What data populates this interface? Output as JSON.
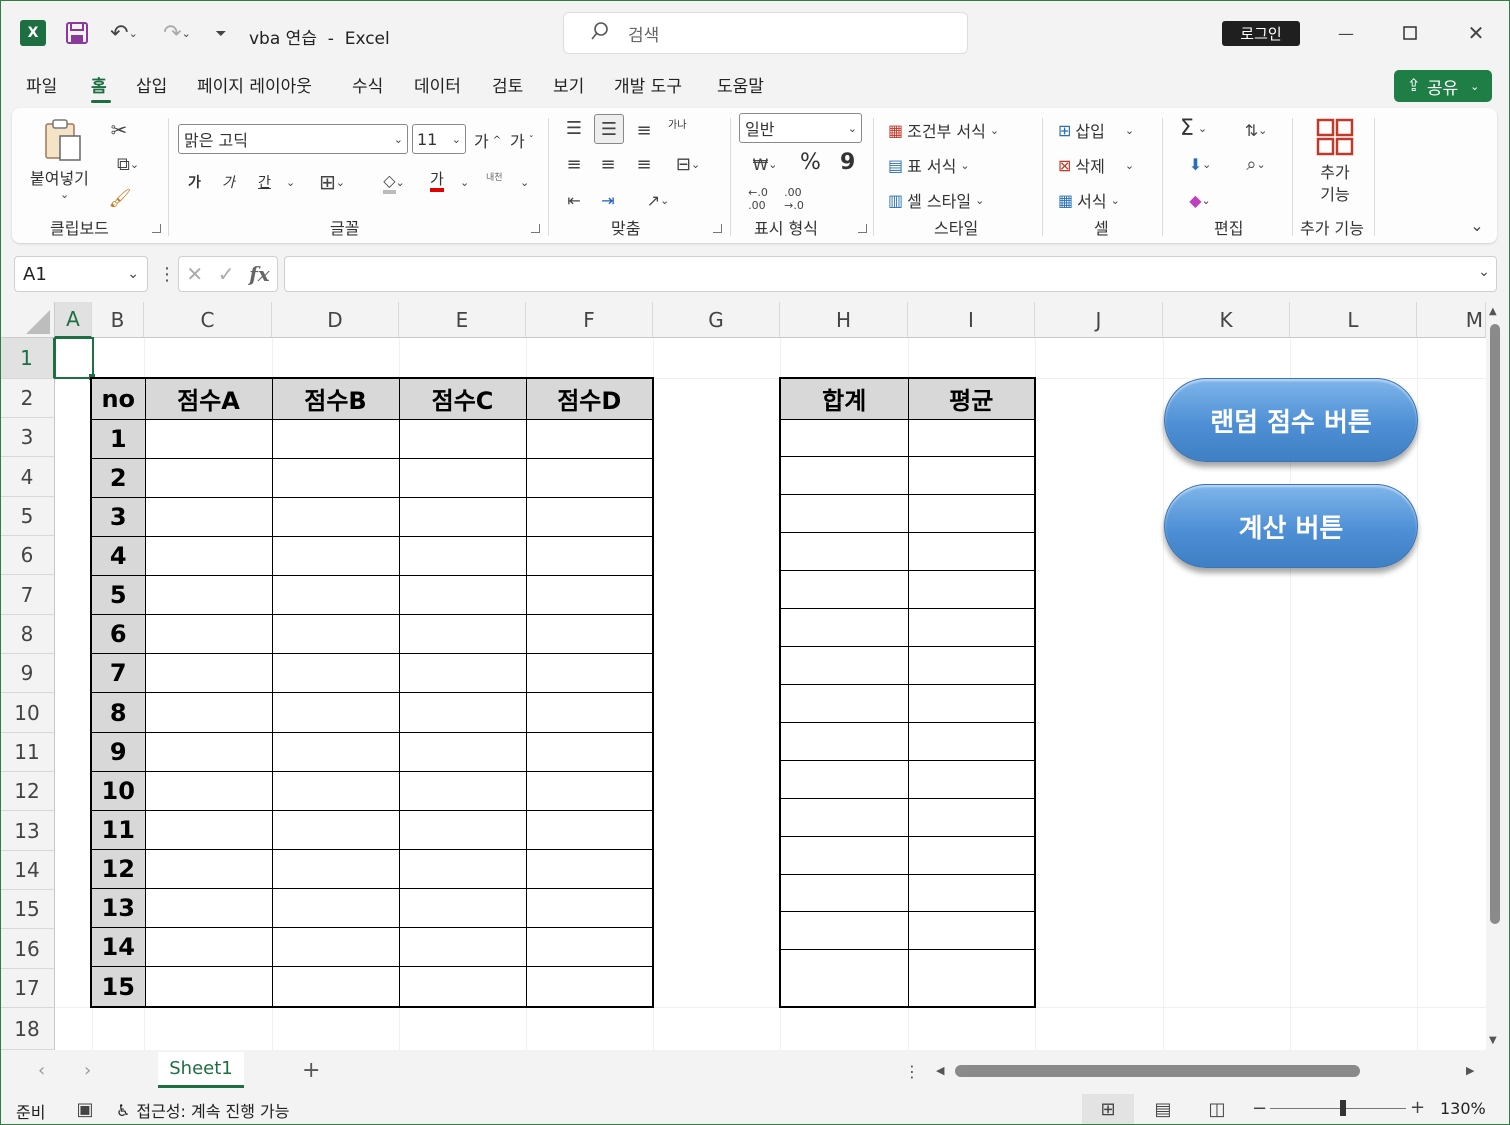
{
  "titlebar": {
    "app_icon": "excel-logo-icon",
    "save_icon": "save-icon",
    "undo_icon": "undo-icon",
    "redo_icon": "redo-icon",
    "customize_icon": "customize-toolbar-icon",
    "title": "vba 연습  -  Excel",
    "search_placeholder": "검색",
    "login_label": "로그인",
    "minimize": "—",
    "maximize": "☐",
    "close": "✕"
  },
  "menu": {
    "tabs": [
      "파일",
      "홈",
      "삽입",
      "페이지 레이아웃",
      "수식",
      "데이터",
      "검토",
      "보기",
      "개발 도구",
      "도움말"
    ],
    "active": "홈",
    "share_label": "공유"
  },
  "ribbon": {
    "clipboard": {
      "paste_label": "붙여넣기",
      "group": "클립보드"
    },
    "font": {
      "font_name": "맑은 고딕",
      "font_size": "11",
      "bold": "가",
      "italic": "가",
      "underline": "간",
      "font_color_glyph": "가",
      "grow": "가",
      "shrink": "가",
      "phonetic": "내천",
      "group": "글꼴"
    },
    "alignment": {
      "wrap": "가나",
      "group": "맞춤"
    },
    "number": {
      "format": "일반",
      "percent": "%",
      "comma": "9",
      "group": "표시 형식"
    },
    "styles": {
      "conditional": "조건부 서식",
      "table": "표 서식",
      "cell_style": "셀 스타일",
      "group": "스타일"
    },
    "cells": {
      "insert": "삽입",
      "delete": "삭제",
      "format": "서식",
      "group": "셀"
    },
    "editing": {
      "sum": "Σ",
      "group": "편집"
    },
    "addins": {
      "label": "추가 기능",
      "group": "추가 기능"
    }
  },
  "formula_bar": {
    "name_box": "A1",
    "fx": "fx",
    "value": ""
  },
  "sheet": {
    "columns": [
      "A",
      "B",
      "C",
      "D",
      "E",
      "F",
      "G",
      "H",
      "I",
      "J",
      "K",
      "L",
      "M"
    ],
    "rows": [
      "1",
      "2",
      "3",
      "4",
      "5",
      "6",
      "7",
      "8",
      "9",
      "10",
      "11",
      "12",
      "13",
      "14",
      "15",
      "16",
      "17",
      "18"
    ],
    "selected_cell": "A1",
    "score_table": {
      "headers": [
        "no",
        "점수A",
        "점수B",
        "점수C",
        "점수D"
      ],
      "numbers": [
        "1",
        "2",
        "3",
        "4",
        "5",
        "6",
        "7",
        "8",
        "9",
        "10",
        "11",
        "12",
        "13",
        "14",
        "15"
      ]
    },
    "summary_table": {
      "headers": [
        "합계",
        "평균"
      ]
    },
    "buttons": {
      "random": "랜덤 점수 버튼",
      "calc": "계산 버튼"
    }
  },
  "tabs_bar": {
    "sheet_name": "Sheet1",
    "add": "+"
  },
  "status": {
    "ready": "준비",
    "accessibility": "접근성: 계속 진행 가능",
    "zoom": "130%",
    "zoom_level_percent": 130,
    "minus": "−",
    "plus": "+"
  },
  "colors": {
    "accent": "#1d6f42",
    "button_blue": "#4e8fd5"
  }
}
